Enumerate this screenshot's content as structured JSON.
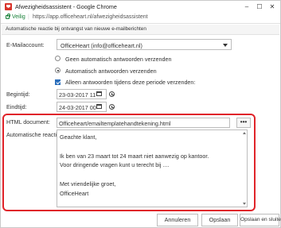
{
  "window": {
    "title": "Afwezigheidsassistent - Google Chrome",
    "minimize_glyph": "–",
    "maximize_glyph": "☐",
    "close_glyph": "✕"
  },
  "addressbar": {
    "secure_label": "Veilig",
    "separator": "|",
    "url": "https://app.officeheart.nl/afwezigheidsassistent"
  },
  "banner": {
    "text": "Automatische reactie bij ontvangst van nieuwe e-mailberichten"
  },
  "form": {
    "email_label": "E-Mailaccount:",
    "email_value": "OfficeHeart (info@officeheart.nl)",
    "options": [
      {
        "label": "Geen automatisch antwoorden verzenden",
        "selected": false
      },
      {
        "label": "Automatisch antwoorden verzenden",
        "selected": true
      }
    ],
    "period_label": "Alleen antwoorden tijdens deze periode verzenden:",
    "period_checked": true,
    "begin_label": "Begintijd:",
    "begin_value": "23-03-2017 11",
    "end_label": "Eindtijd:",
    "end_value": "24-03-2017 00",
    "html_doc_label": "HTML document:",
    "html_doc_value": "Officeheart/emailtemplatehandtekening.html",
    "browse_label": "•••",
    "reply_label": "Automatische reacti",
    "reply_lines": [
      "Geachte klant,",
      "",
      "Ik ben van 23 maart tot 24 maart niet aanwezig op kantoor.",
      "Voor dringende vragen kunt u terecht bij ....",
      "",
      "Met vriendelijke groet,",
      "OfficeHeart"
    ]
  },
  "buttons": {
    "cancel": "Annuleren",
    "save": "Opslaan",
    "save_close": "Opslaan en sluiten"
  },
  "colors": {
    "highlight": "#e0242a",
    "secure": "#188038",
    "checkbox": "#2a6ebb"
  }
}
